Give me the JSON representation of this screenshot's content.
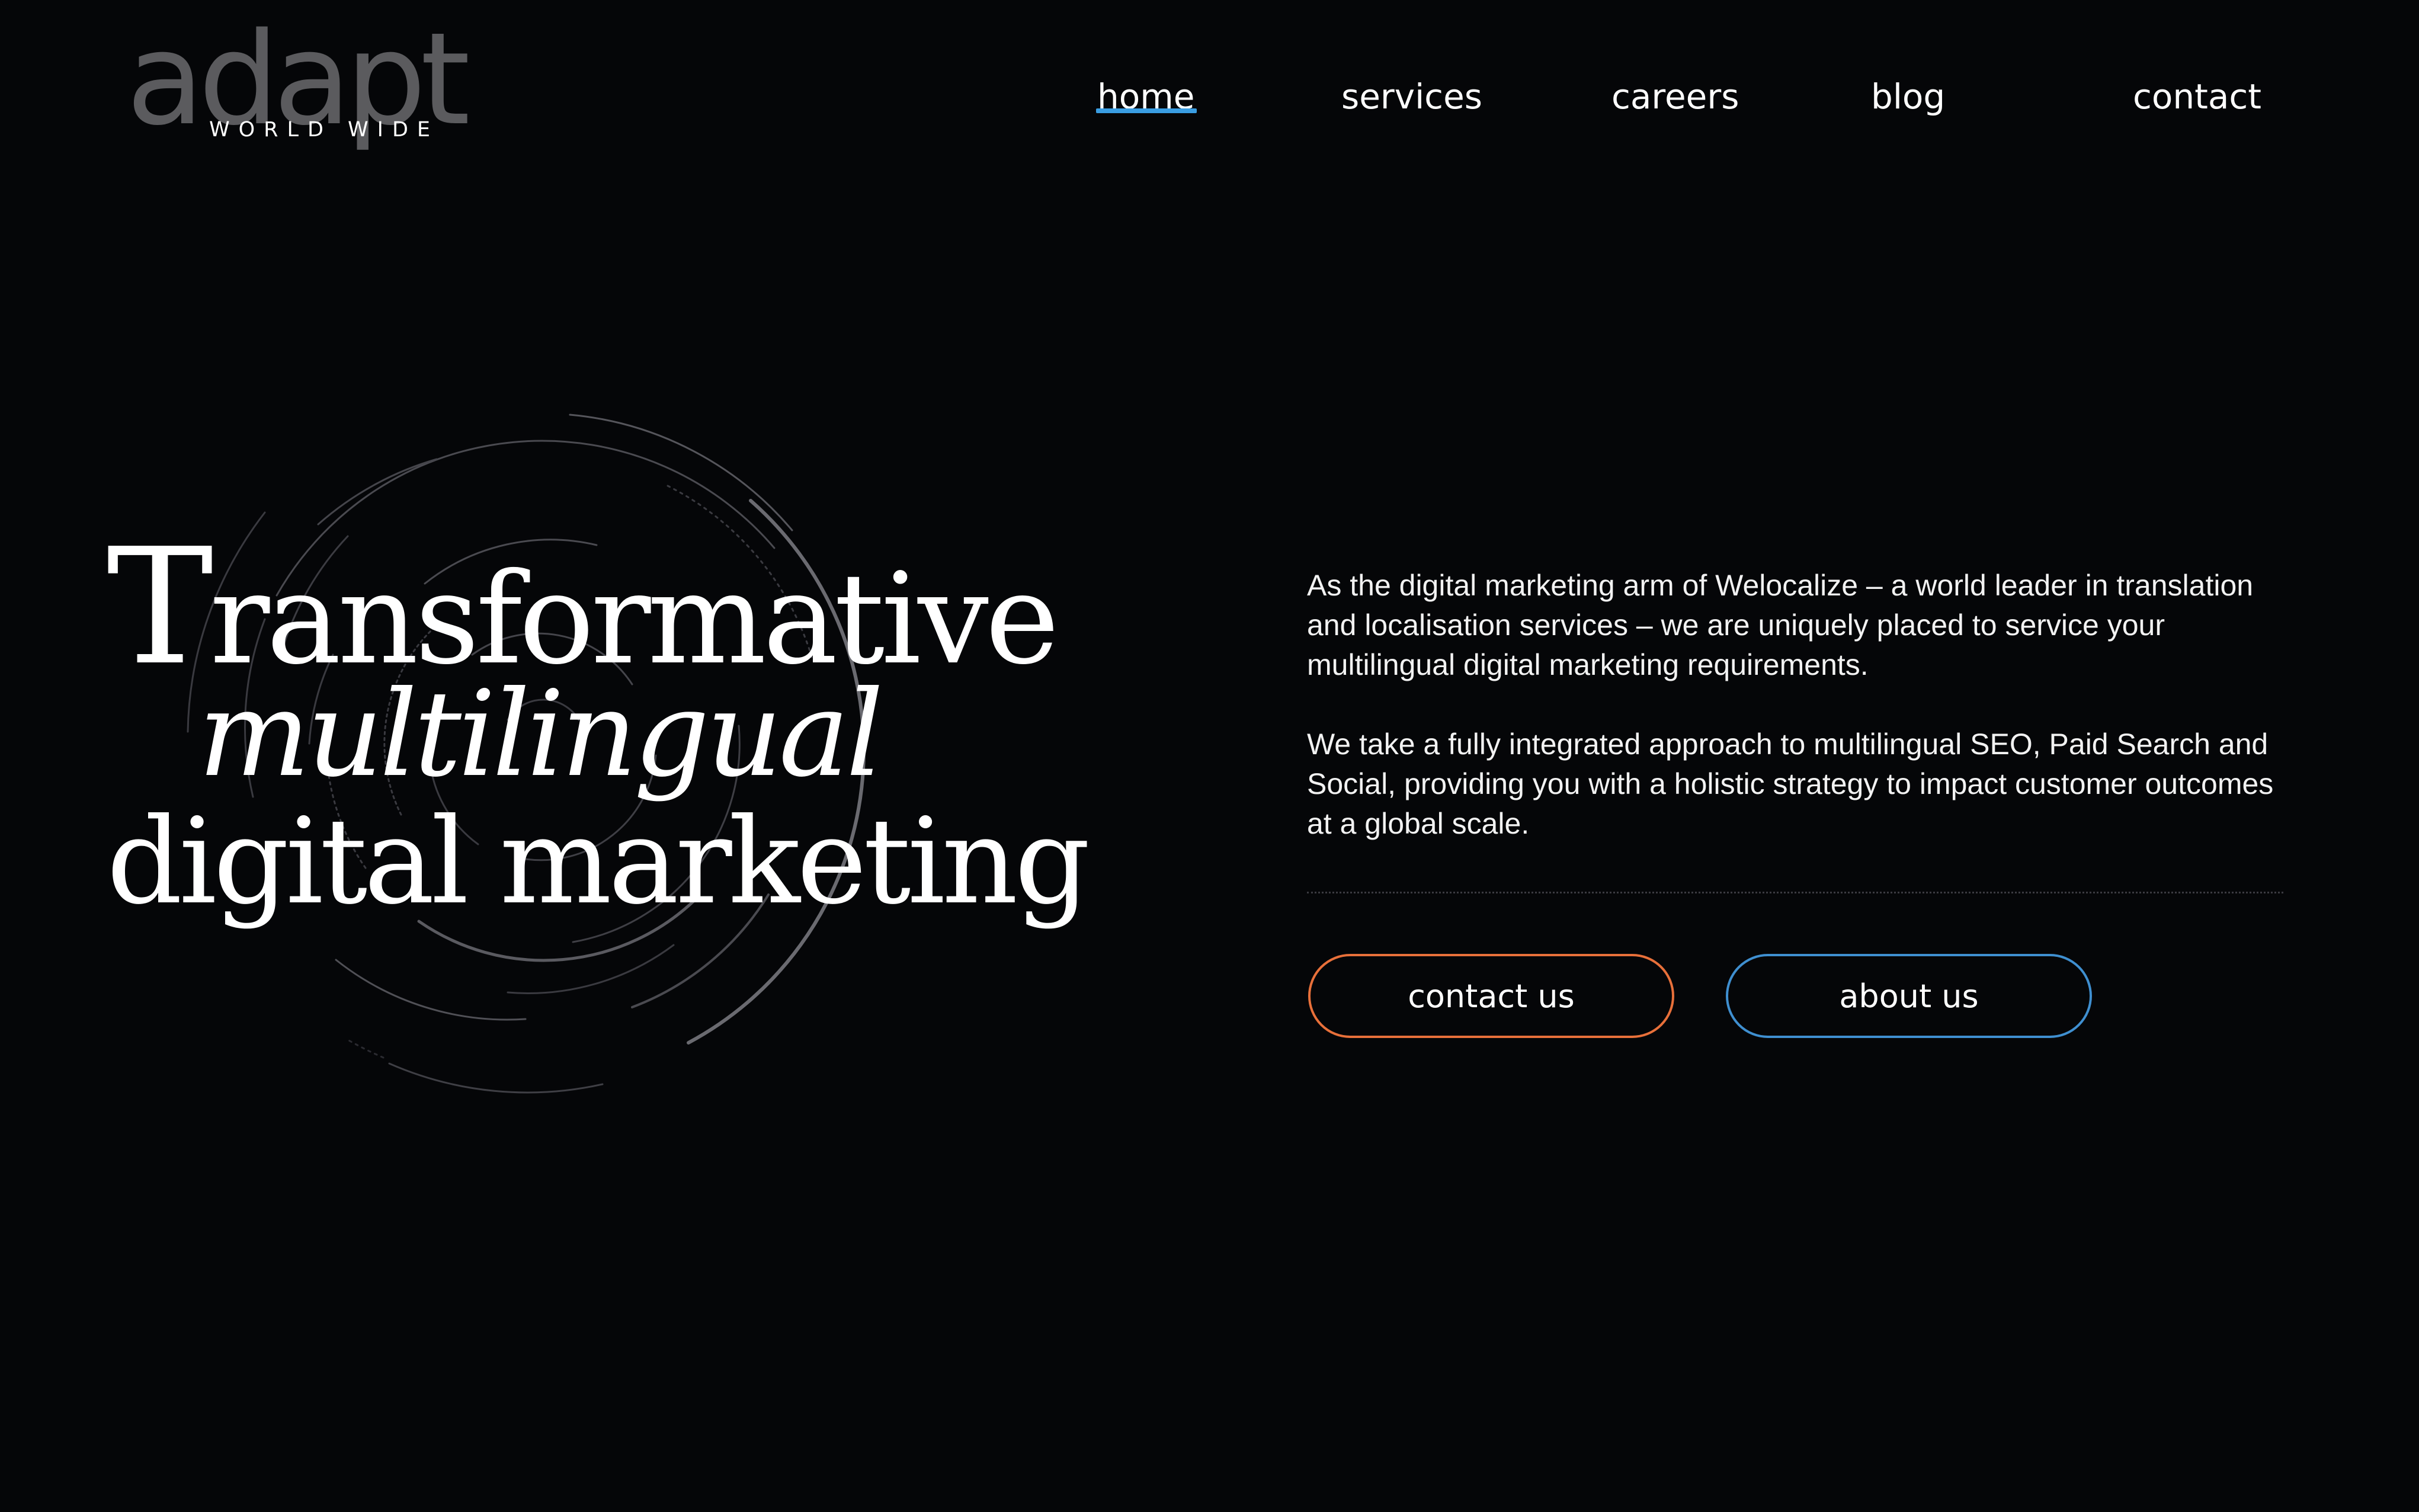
{
  "logo": {
    "word": "adapt",
    "sub": "WORLD WIDE"
  },
  "nav": {
    "items": [
      {
        "label": "home",
        "active": true
      },
      {
        "label": "services"
      },
      {
        "label": "careers"
      },
      {
        "label": "blog"
      },
      {
        "label": "contact"
      }
    ],
    "active_color": "#3a9de2"
  },
  "hero": {
    "line1_cap": "T",
    "line1_rest": "ransformative",
    "line2": "multilingual",
    "line3": "digital marketing"
  },
  "intro": {
    "paragraph1": "As the digital marketing arm of Welocalize – a world leader in translation and localisation services – we are uniquely placed to service your multilingual digital marketing requirements.",
    "paragraph2": "We take a fully integrated approach to multilingual SEO, Paid Search and Social, providing you with a holistic strategy to impact customer outcomes at a global scale."
  },
  "buttons": {
    "contact_label": "contact us",
    "contact_color": "#e8703a",
    "about_label": "about us",
    "about_color": "#3f8fd0"
  },
  "colors": {
    "background": "#050608",
    "text": "#ffffff",
    "logo": "#5b5b5e"
  }
}
